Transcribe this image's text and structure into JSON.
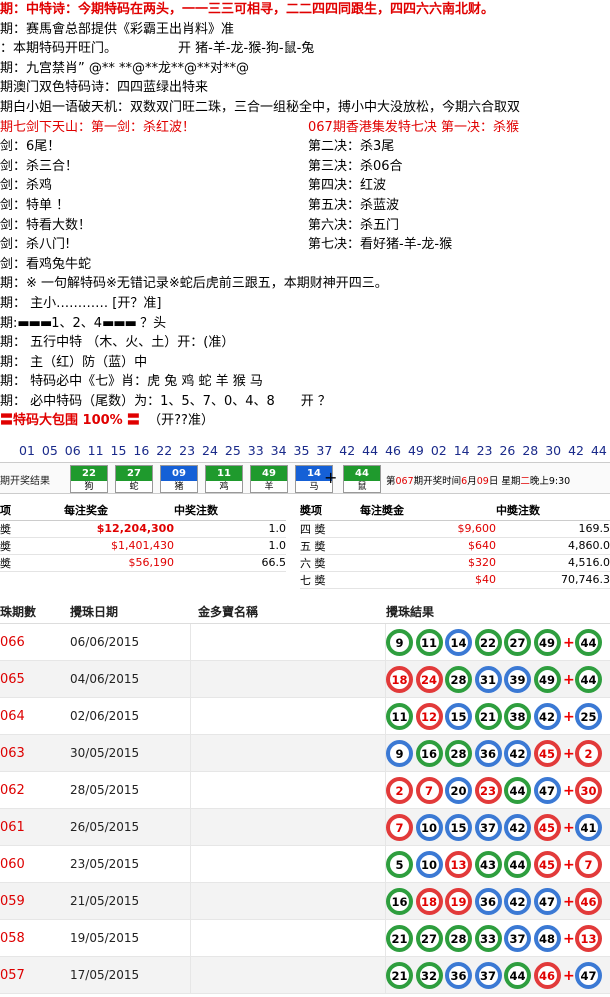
{
  "tips": {
    "l1": "期：中特诗：今期特码在两头，一一三三可相寻，二二四四同跟生，四四六六南北财。",
    "l2": "期：赛馬會总部提供《彩霸王出肖料》准",
    "l3a": "：本期特码开旺门。",
    "l3b": "开 猪-羊-龙-猴-狗-鼠-兔",
    "l4": "期：九宫禁肖” @** **@**龙**@**对**@",
    "l5": "期澳门双色特码诗：四四蓝绿出特来",
    "l6": "期白小姐一语破天机：双数双门旺二珠，三合一组秘全中，搏小中大没放松，今期六合取双",
    "l7a": "期七剑下天山：第一剑：杀红波！",
    "l7b": "067期香港集发特七决 第一决：杀猴",
    "s1l": "剑：6尾！",
    "s1r": "第二决：杀3尾",
    "s2l": "剑：杀三合！",
    "s2r": "第三决：杀06合",
    "s3l": "剑：杀鸡",
    "s3r": "第四决：红波",
    "s4l": "剑：特单 ！",
    "s4r": "第五决：杀蓝波",
    "s5l": "剑：特看大数！",
    "s5r": "第六决：杀五门",
    "s6l": "剑：杀八门!",
    "s6r": "第七决：看好猪-羊-龙-猴",
    "s7l": "剑：看鸡兔牛蛇",
    "l8": "期：※ 一句解特码※无错记录※蛇后虎前三跟五，本期财神开四三。",
    "l9": "期： 主小………… [开？准]",
    "l10a": "期:",
    "l10bars": "▬▬▬",
    "l10mid": "1、2、4",
    "l10end": "？头",
    "l11": "期： 五行中特 （木、火、土）开：(准）",
    "l12": "期： 主（红）防（蓝）中",
    "l13": "期： 特码必中《七》肖：虎 兔 鸡 蛇 羊 猴 马",
    "l14": "期： 必中特码（尾数）为：1、5、7、0、4、8　　开 ？",
    "l15a": "特码大包围 100%",
    "l15b": "（开??准）"
  },
  "numbers_line": "01 05 06 11 15 16 22 23 24 25 33 34 35 37 42 44 46 49 02 14 23 26 28 30 42 44",
  "result_bar": {
    "label": "期开奖结果",
    "balls": [
      {
        "num": "22",
        "zodiac": "狗",
        "color": "#1f9a2d"
      },
      {
        "num": "27",
        "zodiac": "蛇",
        "color": "#1f9a2d"
      },
      {
        "num": "09",
        "zodiac": "猪",
        "color": "#1560d6"
      },
      {
        "num": "11",
        "zodiac": "鸡",
        "color": "#1f9a2d"
      },
      {
        "num": "49",
        "zodiac": "羊",
        "color": "#1f9a2d"
      },
      {
        "num": "14",
        "zodiac": "马",
        "color": "#1560d6"
      }
    ],
    "special": {
      "num": "44",
      "zodiac": "鼠",
      "color": "#1f9a2d"
    },
    "plus": "+",
    "info_prefix": "第",
    "info_issue": "067",
    "info_mid": "期开奖时间",
    "info_month": "6",
    "info_m": "月",
    "info_day": "09",
    "info_d": "日  星期",
    "info_week": "二",
    "info_end": "晚上9:30"
  },
  "prize": {
    "left_headers": [
      "项",
      "每注奖金",
      "中奖注数"
    ],
    "left_rows": [
      {
        "name": "奬",
        "money": "$12,204,300",
        "count": "1.0"
      },
      {
        "name": "奬",
        "money": "$1,401,430",
        "count": "1.0"
      },
      {
        "name": "奬",
        "money": "$56,190",
        "count": "66.5"
      }
    ],
    "right_headers": [
      "奬项",
      "每注奬金",
      "中奬注数"
    ],
    "right_rows": [
      {
        "name": "四 奬",
        "money": "$9,600",
        "count": "169.5"
      },
      {
        "name": "五 奬",
        "money": "$640",
        "count": "4,860.0"
      },
      {
        "name": "六 奬",
        "money": "$320",
        "count": "4,516.0"
      },
      {
        "name": "七 奬",
        "money": "$40",
        "count": "70,746.3"
      }
    ]
  },
  "draws": {
    "headers": [
      "珠期數",
      "攪珠日期",
      "金多寶名稱",
      "攪珠結果"
    ],
    "rows": [
      {
        "issue": "066",
        "date": "06/06/2015",
        "balls": [
          [
            "9",
            "green"
          ],
          [
            "11",
            "green"
          ],
          [
            "14",
            "blue"
          ],
          [
            "22",
            "green"
          ],
          [
            "27",
            "green"
          ],
          [
            "49",
            "green"
          ]
        ],
        "special": [
          "44",
          "green"
        ]
      },
      {
        "issue": "065",
        "date": "04/06/2015",
        "balls": [
          [
            "18",
            "red"
          ],
          [
            "24",
            "red"
          ],
          [
            "28",
            "green"
          ],
          [
            "31",
            "blue"
          ],
          [
            "39",
            "blue"
          ],
          [
            "49",
            "green"
          ]
        ],
        "special": [
          "44",
          "green"
        ]
      },
      {
        "issue": "064",
        "date": "02/06/2015",
        "balls": [
          [
            "11",
            "green"
          ],
          [
            "12",
            "red"
          ],
          [
            "15",
            "blue"
          ],
          [
            "21",
            "green"
          ],
          [
            "38",
            "green"
          ],
          [
            "42",
            "blue"
          ]
        ],
        "special": [
          "25",
          "blue"
        ]
      },
      {
        "issue": "063",
        "date": "30/05/2015",
        "balls": [
          [
            "9",
            "blue"
          ],
          [
            "16",
            "green"
          ],
          [
            "28",
            "green"
          ],
          [
            "36",
            "blue"
          ],
          [
            "42",
            "blue"
          ],
          [
            "45",
            "red"
          ]
        ],
        "special": [
          "2",
          "red"
        ]
      },
      {
        "issue": "062",
        "date": "28/05/2015",
        "balls": [
          [
            "2",
            "red"
          ],
          [
            "7",
            "red"
          ],
          [
            "20",
            "blue"
          ],
          [
            "23",
            "red"
          ],
          [
            "44",
            "green"
          ],
          [
            "47",
            "blue"
          ]
        ],
        "special": [
          "30",
          "red"
        ]
      },
      {
        "issue": "061",
        "date": "26/05/2015",
        "balls": [
          [
            "7",
            "red"
          ],
          [
            "10",
            "blue"
          ],
          [
            "15",
            "blue"
          ],
          [
            "37",
            "blue"
          ],
          [
            "42",
            "blue"
          ],
          [
            "45",
            "red"
          ]
        ],
        "special": [
          "41",
          "blue"
        ]
      },
      {
        "issue": "060",
        "date": "23/05/2015",
        "balls": [
          [
            "5",
            "green"
          ],
          [
            "10",
            "blue"
          ],
          [
            "13",
            "red"
          ],
          [
            "43",
            "green"
          ],
          [
            "44",
            "green"
          ],
          [
            "45",
            "red"
          ]
        ],
        "special": [
          "7",
          "red"
        ]
      },
      {
        "issue": "059",
        "date": "21/05/2015",
        "balls": [
          [
            "16",
            "green"
          ],
          [
            "18",
            "red"
          ],
          [
            "19",
            "red"
          ],
          [
            "36",
            "blue"
          ],
          [
            "42",
            "blue"
          ],
          [
            "47",
            "blue"
          ]
        ],
        "special": [
          "46",
          "red"
        ]
      },
      {
        "issue": "058",
        "date": "19/05/2015",
        "balls": [
          [
            "21",
            "green"
          ],
          [
            "27",
            "green"
          ],
          [
            "28",
            "green"
          ],
          [
            "33",
            "green"
          ],
          [
            "37",
            "blue"
          ],
          [
            "48",
            "blue"
          ]
        ],
        "special": [
          "13",
          "red"
        ]
      },
      {
        "issue": "057",
        "date": "17/05/2015",
        "balls": [
          [
            "21",
            "green"
          ],
          [
            "32",
            "green"
          ],
          [
            "36",
            "blue"
          ],
          [
            "37",
            "blue"
          ],
          [
            "44",
            "green"
          ],
          [
            "46",
            "red"
          ]
        ],
        "special": [
          "47",
          "blue"
        ]
      }
    ]
  }
}
